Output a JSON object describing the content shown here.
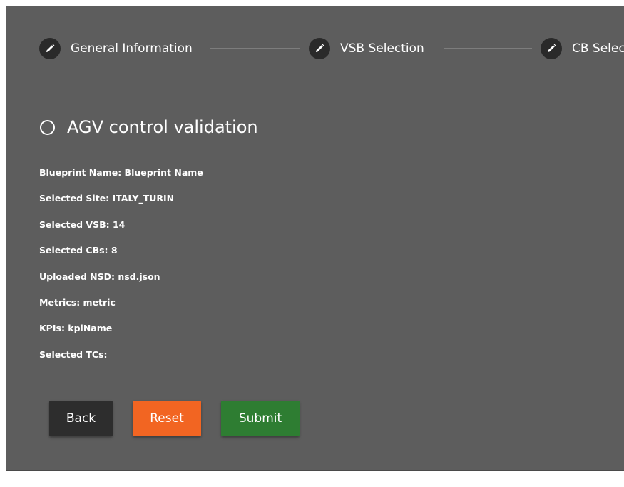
{
  "stepper": {
    "steps": [
      {
        "label": "General Information",
        "icon": "pencil-icon"
      },
      {
        "label": "VSB Selection",
        "icon": "pencil-icon"
      },
      {
        "label": "CB Selec",
        "icon": "pencil-icon"
      }
    ]
  },
  "test_case": {
    "title": "AGV control validation"
  },
  "summary": {
    "items": [
      "Blueprint Name: Blueprint Name",
      "Selected Site: ITALY_TURIN",
      "Selected VSB: 14",
      "Selected CBs: 8",
      "Uploaded NSD: nsd.json",
      "Metrics: metric",
      "KPIs: kpiName",
      "Selected TCs:"
    ]
  },
  "buttons": {
    "back": "Back",
    "reset": "Reset",
    "submit": "Submit"
  },
  "colors": {
    "panel": "#5d5d5d",
    "step_icon": "#2a2a2a",
    "back": "#2d2d2d",
    "reset": "#f26522",
    "submit": "#2e7d32"
  }
}
